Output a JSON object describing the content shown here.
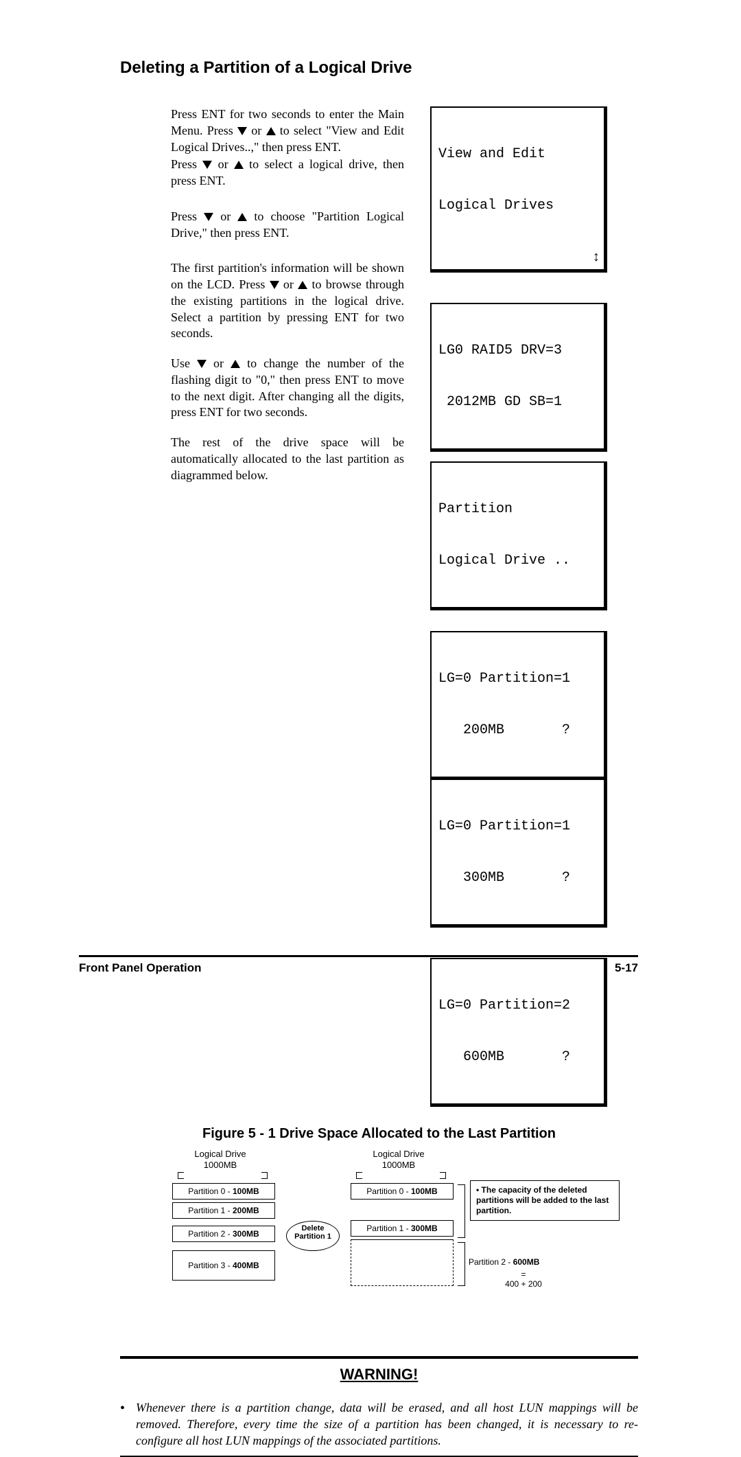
{
  "heading": "Deleting a Partition of a Logical Drive",
  "paragraphs": {
    "p1a": "Press ENT for two seconds to enter the Main Menu. Press ",
    "p1b": " or ",
    "p1c": " to select \"View and Edit Logical Drives..,\" then press ENT.",
    "p2a": "Press ",
    "p2b": " or ",
    "p2c": " to select a logical drive, then press ENT.",
    "p3a": "Press ",
    "p3b": " or ",
    "p3c": " to choose \"Partition Logical Drive,\" then press ENT.",
    "p4a": "The first partition's information will be shown on the LCD. Press ",
    "p4b": " or ",
    "p4c": " to browse through the existing partitions in the logical drive. Select a partition by pressing ENT for two seconds.",
    "p5a": "Use ",
    "p5b": " or ",
    "p5c": " to change the number of the flashing digit to \"0,\" then press ENT to move to the next digit. After changing all the digits, press ENT for two seconds.",
    "p6": "The rest of the drive space will be automatically allocated to the last partition as diagrammed below."
  },
  "lcd": {
    "s1l1": "View and Edit",
    "s1l2": "Logical Drives ",
    "s2l1": "LG0 RAID5 DRV=3",
    "s2l2": " 2012MB GD SB=1",
    "s3l1": "Partition",
    "s3l2": "Logical Drive ..",
    "s4l1": "LG=0 Partition=1",
    "s4l2": "   200MB       ?",
    "s5l1": "LG=0 Partition=1",
    "s5l2": "   300MB       ?",
    "s6l1": "LG=0 Partition=2",
    "s6l2": "   600MB       ?",
    "updown": "↕"
  },
  "figure": {
    "title": "Figure 5 - 1 Drive Space Allocated to the Last Partition",
    "top_left": "Logical Drive\n1000MB",
    "top_right": "Logical Drive\n1000MB",
    "a0_label": "Partition 0 - ",
    "a0_val": "100MB",
    "a1_label": "Partition 1 - ",
    "a1_val": "200MB",
    "a2_label": "Partition 2 - ",
    "a2_val": "300MB",
    "a3_label": "Partition 3 - ",
    "a3_val": "400MB",
    "b0_label": "Partition 0 - ",
    "b0_val": "100MB",
    "b1_label": "Partition 1 - ",
    "b1_val": "300MB",
    "b2_label": "Partition 2 - ",
    "b2_val": "600MB",
    "b2_sum": "=\n400 + 200",
    "note": "The capacity of the deleted partitions will be added to the last partition.",
    "note_bullet": "•",
    "arrow_label": "Delete\nPartition 1"
  },
  "warning": {
    "title": "WARNING!",
    "bullet": "•",
    "text": "Whenever there is a partition change, data will be erased, and all host LUN mappings will be removed. Therefore, every time the size of a partition has been changed, it is necessary to re-configure all host LUN mappings of the associated partitions."
  },
  "footer": {
    "left": "Front Panel Operation",
    "right": "5-17"
  }
}
